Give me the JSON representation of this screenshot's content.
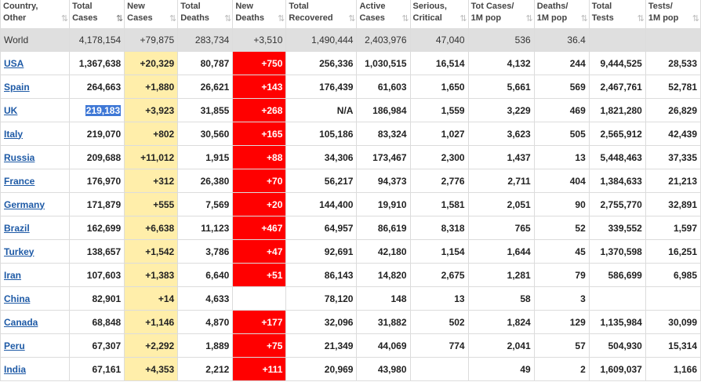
{
  "headers": [
    {
      "line1": "Country,",
      "line2": "Other"
    },
    {
      "line1": "Total",
      "line2": "Cases"
    },
    {
      "line1": "New",
      "line2": "Cases"
    },
    {
      "line1": "Total",
      "line2": "Deaths"
    },
    {
      "line1": "New",
      "line2": "Deaths"
    },
    {
      "line1": "Total",
      "line2": "Recovered"
    },
    {
      "line1": "Active",
      "line2": "Cases"
    },
    {
      "line1": "Serious,",
      "line2": "Critical"
    },
    {
      "line1": "Tot Cases/",
      "line2": "1M pop"
    },
    {
      "line1": "Deaths/",
      "line2": "1M pop"
    },
    {
      "line1": "Total",
      "line2": "Tests"
    },
    {
      "line1": "Tests/",
      "line2": "1M pop"
    }
  ],
  "sort_icon": "⇅",
  "sort_icon_active": "⇅",
  "world": [
    "World",
    "4,178,154",
    "+79,875",
    "283,734",
    "+3,510",
    "1,490,444",
    "2,403,976",
    "47,040",
    "536",
    "36.4",
    "",
    ""
  ],
  "rows": [
    [
      "USA",
      "1,367,638",
      "+20,329",
      "80,787",
      "+750",
      "256,336",
      "1,030,515",
      "16,514",
      "4,132",
      "244",
      "9,444,525",
      "28,533"
    ],
    [
      "Spain",
      "264,663",
      "+1,880",
      "26,621",
      "+143",
      "176,439",
      "61,603",
      "1,650",
      "5,661",
      "569",
      "2,467,761",
      "52,781"
    ],
    [
      "UK",
      "219,183",
      "+3,923",
      "31,855",
      "+268",
      "N/A",
      "186,984",
      "1,559",
      "3,229",
      "469",
      "1,821,280",
      "26,829"
    ],
    [
      "Italy",
      "219,070",
      "+802",
      "30,560",
      "+165",
      "105,186",
      "83,324",
      "1,027",
      "3,623",
      "505",
      "2,565,912",
      "42,439"
    ],
    [
      "Russia",
      "209,688",
      "+11,012",
      "1,915",
      "+88",
      "34,306",
      "173,467",
      "2,300",
      "1,437",
      "13",
      "5,448,463",
      "37,335"
    ],
    [
      "France",
      "176,970",
      "+312",
      "26,380",
      "+70",
      "56,217",
      "94,373",
      "2,776",
      "2,711",
      "404",
      "1,384,633",
      "21,213"
    ],
    [
      "Germany",
      "171,879",
      "+555",
      "7,569",
      "+20",
      "144,400",
      "19,910",
      "1,581",
      "2,051",
      "90",
      "2,755,770",
      "32,891"
    ],
    [
      "Brazil",
      "162,699",
      "+6,638",
      "11,123",
      "+467",
      "64,957",
      "86,619",
      "8,318",
      "765",
      "52",
      "339,552",
      "1,597"
    ],
    [
      "Turkey",
      "138,657",
      "+1,542",
      "3,786",
      "+47",
      "92,691",
      "42,180",
      "1,154",
      "1,644",
      "45",
      "1,370,598",
      "16,251"
    ],
    [
      "Iran",
      "107,603",
      "+1,383",
      "6,640",
      "+51",
      "86,143",
      "14,820",
      "2,675",
      "1,281",
      "79",
      "586,699",
      "6,985"
    ],
    [
      "China",
      "82,901",
      "+14",
      "4,633",
      "",
      "78,120",
      "148",
      "13",
      "58",
      "3",
      "",
      ""
    ],
    [
      "Canada",
      "68,848",
      "+1,146",
      "4,870",
      "+177",
      "32,096",
      "31,882",
      "502",
      "1,824",
      "129",
      "1,135,984",
      "30,099"
    ],
    [
      "Peru",
      "67,307",
      "+2,292",
      "1,889",
      "+75",
      "21,349",
      "44,069",
      "774",
      "2,041",
      "57",
      "504,930",
      "15,314"
    ],
    [
      "India",
      "67,161",
      "+4,353",
      "2,212",
      "+111",
      "20,969",
      "43,980",
      "",
      "49",
      "2",
      "1,609,037",
      "1,166"
    ]
  ],
  "colors": {
    "new_cases_bg": "#ffeeaa",
    "new_deaths_bg": "#ff0000",
    "link": "#1e5aa6",
    "world_bg": "#dfdfdf",
    "selection": "#3f78d6"
  }
}
